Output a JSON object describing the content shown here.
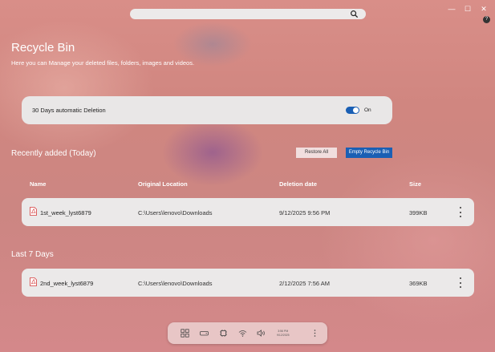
{
  "search": {
    "placeholder": ""
  },
  "window_controls": {
    "minimize": "—",
    "maximize": "☐",
    "close": "✕"
  },
  "page": {
    "title": "Recycle Bin",
    "subtitle": "Here you can Manage your deleted files, folders, images and videos."
  },
  "auto_delete": {
    "label": "30 Days automatic Deletion",
    "state": "On",
    "enabled": true
  },
  "recent": {
    "heading": "Recently added (Today)",
    "restore_label": "Restore All",
    "empty_label": "Empty Recycle Bin"
  },
  "columns": {
    "name": "Name",
    "location": "Original Location",
    "date": "Deletion date",
    "size": "Size"
  },
  "rows_today": [
    {
      "name": "1st_week_lyst6879",
      "location": "C:\\Users\\lenovo\\Downloads",
      "date": "9/12/2025 9:56 PM",
      "size": "399KB"
    }
  ],
  "last7": {
    "heading": "Last 7 Days",
    "rows": [
      {
        "name": "2nd_week_lyst6879",
        "location": "C:\\Users\\lenovo\\Downloads",
        "date": "2/12/2025 7:56 AM",
        "size": "369KB"
      }
    ]
  },
  "taskbar": {
    "icons": [
      "apps-grid-icon",
      "drive-icon",
      "chip-icon",
      "wifi-icon",
      "speaker-icon",
      "more-icon"
    ],
    "time": "3:56 PM",
    "date": "9/12/2025"
  },
  "colors": {
    "accent": "#1a5fb4",
    "card": "#ebe9e9",
    "restore_bg": "#f1dede"
  }
}
